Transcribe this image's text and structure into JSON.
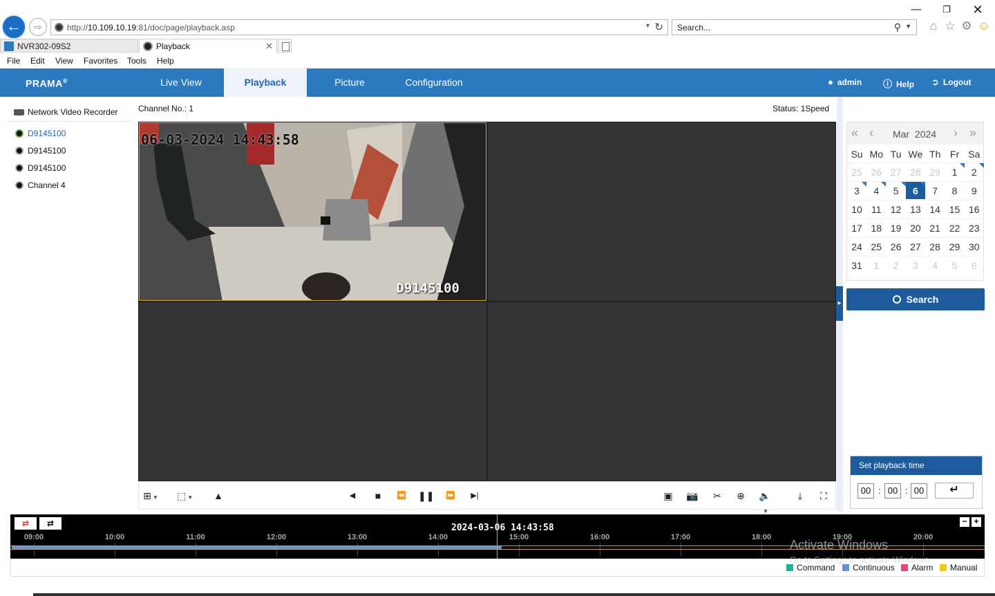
{
  "browser": {
    "url_prefix": "http://",
    "url_host": "10.109.10.19",
    "url_path": ":81/doc/page/playback.asp",
    "search_placeholder": "Search...",
    "tabs": [
      {
        "label": "NVR302-09S2"
      },
      {
        "label": "Playback"
      }
    ],
    "menu": [
      "File",
      "Edit",
      "View",
      "Favorites",
      "Tools",
      "Help"
    ]
  },
  "app": {
    "logo": "PRAMA",
    "nav": [
      "Live View",
      "Playback",
      "Picture",
      "Configuration"
    ],
    "active_nav": "Playback",
    "user": "admin",
    "help": "Help",
    "logout": "Logout"
  },
  "tree": {
    "root": "Network Video Recorder",
    "items": [
      {
        "label": "D9145100",
        "selected": true
      },
      {
        "label": "D9145100",
        "selected": false
      },
      {
        "label": "D9145100",
        "selected": false
      },
      {
        "label": "Channel 4",
        "selected": false
      }
    ]
  },
  "video": {
    "channel_label": "Channel No.: 1",
    "status_label": "Status: 1Speed",
    "osd_time": "06-03-2024 14:43:58",
    "osd_name": "D9145100"
  },
  "calendar": {
    "month": "Mar",
    "year": "2024",
    "weekdays": [
      "Su",
      "Mo",
      "Tu",
      "We",
      "Th",
      "Fr",
      "Sa"
    ],
    "days": [
      [
        "25",
        "26",
        "27",
        "28",
        "29",
        "1",
        "2"
      ],
      [
        "3",
        "4",
        "5",
        "6",
        "7",
        "8",
        "9"
      ],
      [
        "10",
        "11",
        "12",
        "13",
        "14",
        "15",
        "16"
      ],
      [
        "17",
        "18",
        "19",
        "20",
        "21",
        "22",
        "23"
      ],
      [
        "24",
        "25",
        "26",
        "27",
        "28",
        "29",
        "30"
      ],
      [
        "31",
        "1",
        "2",
        "3",
        "4",
        "5",
        "6"
      ]
    ],
    "selected_day": "6",
    "search_label": "Search"
  },
  "set_time": {
    "title": "Set playback time",
    "hh": "00",
    "mm": "00",
    "ss": "00"
  },
  "timeline": {
    "current": "2024-03-06 14:43:58",
    "hours": [
      "09:00",
      "10:00",
      "11:00",
      "12:00",
      "13:00",
      "14:00",
      "15:00",
      "16:00",
      "17:00",
      "18:00",
      "19:00",
      "20:00"
    ]
  },
  "legend": [
    {
      "label": "Command",
      "color": "#1ab394"
    },
    {
      "label": "Continuous",
      "color": "#6a8ed8"
    },
    {
      "label": "Alarm",
      "color": "#e8457c"
    },
    {
      "label": "Manual",
      "color": "#f2c811"
    }
  ],
  "watermark": {
    "line1": "Activate Windows",
    "line2": "Go to Settings to activate Windows."
  }
}
